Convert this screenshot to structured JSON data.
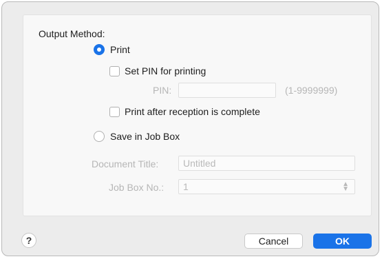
{
  "dialog": {
    "output_method_label": "Output Method:",
    "print_option": {
      "label": "Print",
      "selected": true
    },
    "set_pin": {
      "label": "Set PIN for printing",
      "checked": false
    },
    "pin": {
      "label": "PIN:",
      "value": "",
      "range_hint": "(1-9999999)"
    },
    "print_after_reception": {
      "label": "Print after reception is complete",
      "checked": false
    },
    "save_job_box_option": {
      "label": "Save in Job Box",
      "selected": false
    },
    "document_title": {
      "label": "Document Title:",
      "placeholder": "Untitled"
    },
    "job_box_no": {
      "label": "Job Box No.:",
      "value": "1"
    }
  },
  "footer": {
    "help_label": "?",
    "cancel_label": "Cancel",
    "ok_label": "OK"
  },
  "colors": {
    "accent": "#1a73e8",
    "disabled_text": "#b6b6b6"
  }
}
